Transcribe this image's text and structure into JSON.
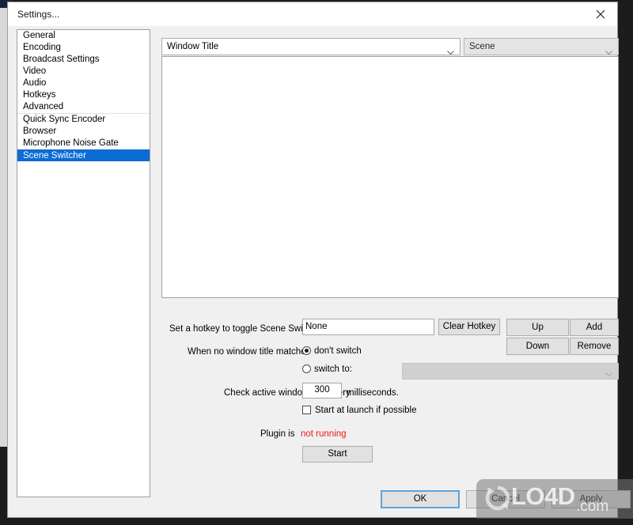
{
  "window": {
    "title": "Settings...",
    "close_icon": "close-icon"
  },
  "sidebar": {
    "items": [
      {
        "label": "General",
        "selected": false,
        "separator_above": false
      },
      {
        "label": "Encoding",
        "selected": false,
        "separator_above": false
      },
      {
        "label": "Broadcast Settings",
        "selected": false,
        "separator_above": false
      },
      {
        "label": "Video",
        "selected": false,
        "separator_above": false
      },
      {
        "label": "Audio",
        "selected": false,
        "separator_above": false
      },
      {
        "label": "Hotkeys",
        "selected": false,
        "separator_above": false
      },
      {
        "label": "Advanced",
        "selected": false,
        "separator_above": false
      },
      {
        "label": "Quick Sync Encoder",
        "selected": false,
        "separator_above": true
      },
      {
        "label": "Browser",
        "selected": false,
        "separator_above": false
      },
      {
        "label": "Microphone Noise Gate",
        "selected": false,
        "separator_above": false
      },
      {
        "label": "Scene Switcher",
        "selected": true,
        "separator_above": false
      }
    ]
  },
  "main": {
    "window_title_combo": {
      "value": "Window Title",
      "arrow_icon": "chevron-down-icon"
    },
    "scene_combo": {
      "value": "Scene",
      "arrow_icon": "chevron-down-icon",
      "disabled": true
    },
    "entries_list": {
      "items": []
    },
    "hotkey": {
      "label": "Set a hotkey to toggle Scene Switcher:",
      "value": "None",
      "clear_label": "Clear Hotkey"
    },
    "list_buttons": {
      "up": "Up",
      "add": "Add",
      "down": "Down",
      "remove": "Remove"
    },
    "no_match": {
      "label": "When no window title matches",
      "option_dont_switch": "don't switch",
      "option_switch_to": "switch to:",
      "selected": "don't switch",
      "switch_to_combo_value": "",
      "switch_to_arrow_icon": "chevron-down-icon"
    },
    "interval": {
      "label": "Check active window title every",
      "value": "300",
      "unit": "milliseconds."
    },
    "startup": {
      "label": "Start at launch if possible",
      "checked": false
    },
    "plugin_status": {
      "label": "Plugin is",
      "value": "not running",
      "color": "#f01818"
    },
    "start_button": "Start"
  },
  "footer": {
    "ok": "OK",
    "cancel": "Cancel",
    "apply": "Apply"
  },
  "watermark": {
    "brand": "LO4D",
    "tld": ".com",
    "logo_icon": "refresh-circle-icon"
  }
}
